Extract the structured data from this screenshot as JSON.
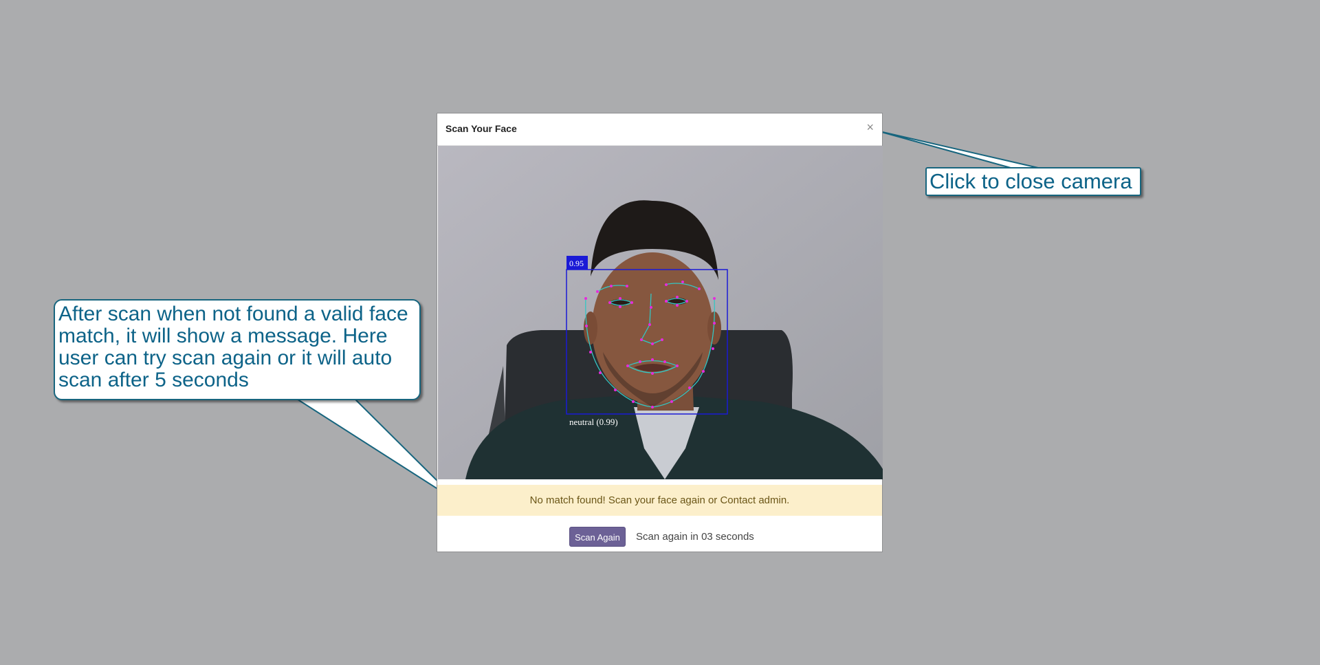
{
  "modal": {
    "title": "Scan Your Face",
    "close_symbol": "×",
    "detection": {
      "score": "0.95",
      "expression": "neutral (0.99)"
    },
    "alert_message": "No match found! Scan your face again or Contact admin.",
    "scan_again_label": "Scan Again",
    "countdown_text": "Scan again in 03 seconds"
  },
  "annotations": {
    "close_camera": "Click to close camera",
    "no_match_help": "After scan when not found a valid face match, it will show a message. Here user can try scan again or it will auto scan after 5 seconds"
  },
  "icons": {
    "close": "close-icon"
  },
  "colors": {
    "overlay_bg": "#abacae",
    "detection_box": "#1a1ad6",
    "landmarks": "#e62bdc",
    "landmark_lines": "#34c6c3",
    "alert_bg": "#fcefcb",
    "alert_text": "#6b5617",
    "button_bg": "#6c6196",
    "callout_text": "#0d6388"
  }
}
